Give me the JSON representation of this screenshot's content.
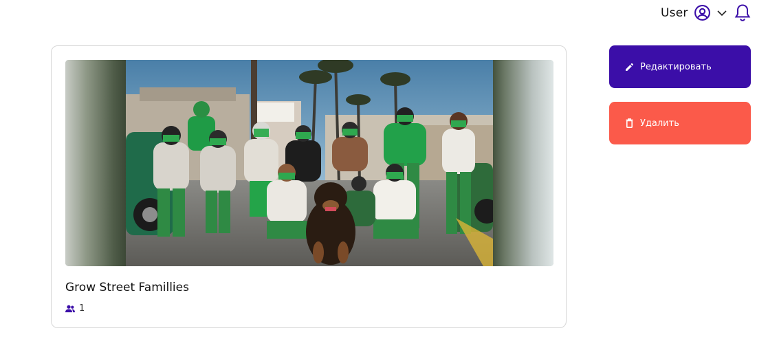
{
  "header": {
    "user_name": "User",
    "icons": [
      "user-circle-icon",
      "chevron-down-icon",
      "bell-icon"
    ],
    "accent_color": "#3b0ea8"
  },
  "card": {
    "title": "Grow Street Famillies",
    "members_count": "1",
    "members_icon": "users-icon",
    "image": "group-photo"
  },
  "actions": {
    "edit_label": "Редактировать",
    "edit_icon": "pencil-icon",
    "edit_color": "#3b0ea8",
    "delete_label": "Удалить",
    "delete_icon": "trash-icon",
    "delete_color": "#fb5a4a"
  }
}
